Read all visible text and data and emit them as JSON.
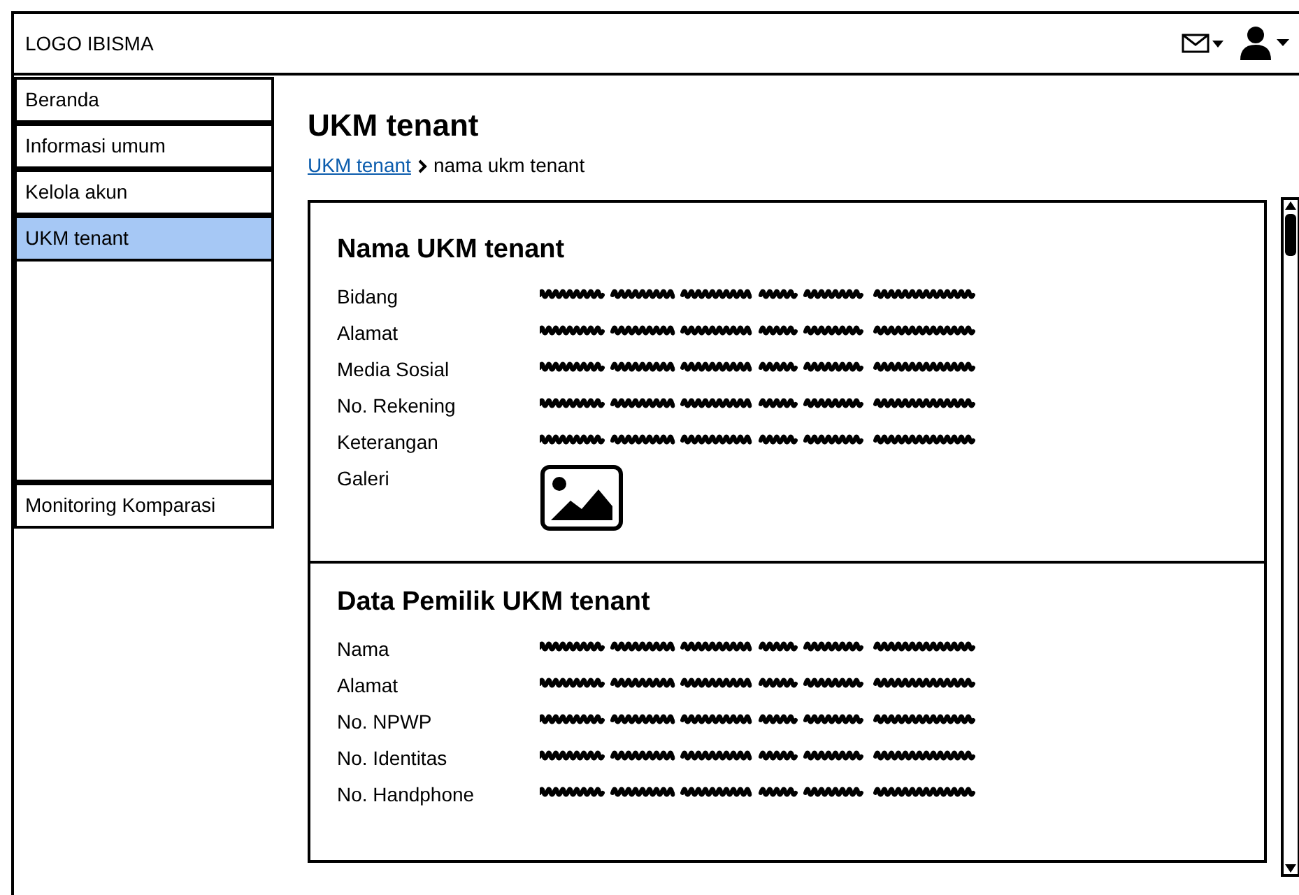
{
  "header": {
    "logo": "LOGO IBISMA"
  },
  "sidebar": {
    "items": [
      {
        "label": "Beranda",
        "selected": false
      },
      {
        "label": "Informasi umum",
        "selected": false
      },
      {
        "label": "Kelola akun",
        "selected": false
      },
      {
        "label": "UKM tenant",
        "selected": true
      }
    ],
    "bottom_items": [
      {
        "label": "Monitoring Komparasi",
        "selected": false
      }
    ]
  },
  "page": {
    "title": "UKM tenant",
    "breadcrumb": {
      "link": "UKM tenant",
      "current": "nama ukm tenant"
    }
  },
  "sections": [
    {
      "title": "Nama UKM tenant",
      "fields": [
        {
          "label": "Bidang",
          "kind": "text"
        },
        {
          "label": "Alamat",
          "kind": "text"
        },
        {
          "label": "Media Sosial",
          "kind": "text"
        },
        {
          "label": "No. Rekening",
          "kind": "text"
        },
        {
          "label": "Keterangan",
          "kind": "text"
        },
        {
          "label": "Galeri",
          "kind": "image"
        }
      ]
    },
    {
      "title": "Data Pemilik UKM tenant",
      "fields": [
        {
          "label": "Nama",
          "kind": "text"
        },
        {
          "label": "Alamat",
          "kind": "text"
        },
        {
          "label": "No. NPWP",
          "kind": "text"
        },
        {
          "label": "No. Identitas",
          "kind": "text"
        },
        {
          "label": "No. Handphone",
          "kind": "text"
        }
      ]
    }
  ]
}
